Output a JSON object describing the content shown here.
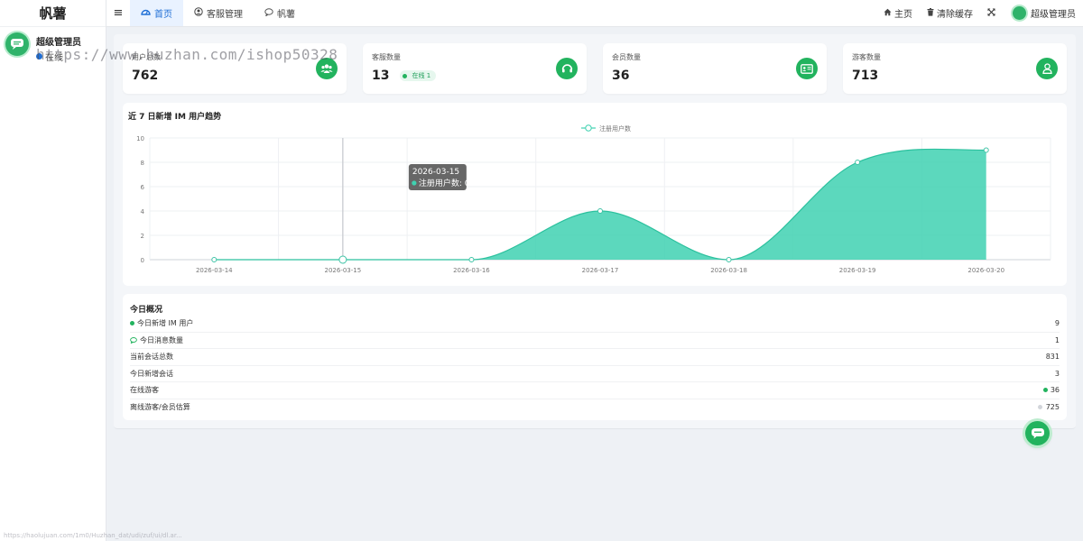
{
  "app": {
    "brand": "帆薯"
  },
  "sidebar": {
    "user_name": "超级管理员",
    "user_status": "在线"
  },
  "topbar": {
    "tabs": [
      {
        "label": "首页",
        "icon": "dashboard-icon",
        "active": true
      },
      {
        "label": "客服管理",
        "icon": "user-circle-icon",
        "active": false
      },
      {
        "label": "帆薯",
        "icon": "comment-icon",
        "active": false
      }
    ],
    "links": {
      "home": "主页",
      "clear_cache": "清除缓存",
      "user": "超级管理员"
    }
  },
  "watermark": "https://www.huzhan.com/ishop50328",
  "watermark_bottom": "https://haolujuan.com/1m0/Huzhan_dat/udi/zuf/ui/dl.ar...",
  "stats": [
    {
      "label": "用户总数",
      "value": "762",
      "icon": "users-icon"
    },
    {
      "label": "客服数量",
      "value": "13",
      "badge": "在线 1",
      "icon": "headset-icon"
    },
    {
      "label": "会员数量",
      "value": "36",
      "icon": "id-card-icon"
    },
    {
      "label": "游客数量",
      "value": "713",
      "icon": "user-icon"
    }
  ],
  "chart_card": {
    "title": "近 7 日新增 IM 用户趋势"
  },
  "chart_data": {
    "type": "area",
    "title": "近 7 日新增 IM 用户趋势",
    "x": [
      "2026-03-14",
      "2026-03-15",
      "2026-03-16",
      "2026-03-17",
      "2026-03-18",
      "2026-03-19",
      "2026-03-20"
    ],
    "series": [
      {
        "name": "注册用户数",
        "values": [
          0,
          0,
          0,
          4,
          0,
          8,
          9
        ]
      }
    ],
    "ylim": [
      0,
      10
    ],
    "yticks": [
      "0",
      "2",
      "4",
      "6",
      "8",
      "10"
    ],
    "grid": true,
    "legend": "top-center",
    "color": "#3fd1b1",
    "tooltip": {
      "date": "2026-03-15",
      "label": "注册用户数: 0"
    }
  },
  "overview": {
    "title": "今日概况",
    "rows": [
      {
        "label": "今日新增 IM 用户",
        "value": "9",
        "label_icon": "green-dot"
      },
      {
        "label": "今日消息数量",
        "value": "1",
        "label_icon": "comment-icon"
      },
      {
        "label": "当前会话总数",
        "value": "831"
      },
      {
        "label": "今日新增会话",
        "value": "3"
      },
      {
        "label": "在线游客",
        "value": "36",
        "value_icon": "green-dot"
      },
      {
        "label": "离线游客/会员估算",
        "value": "725",
        "value_icon": "grey-dot"
      }
    ]
  },
  "colors": {
    "primary": "#1f6fd6",
    "green": "#22b35e",
    "teal": "#3fd1b1"
  }
}
